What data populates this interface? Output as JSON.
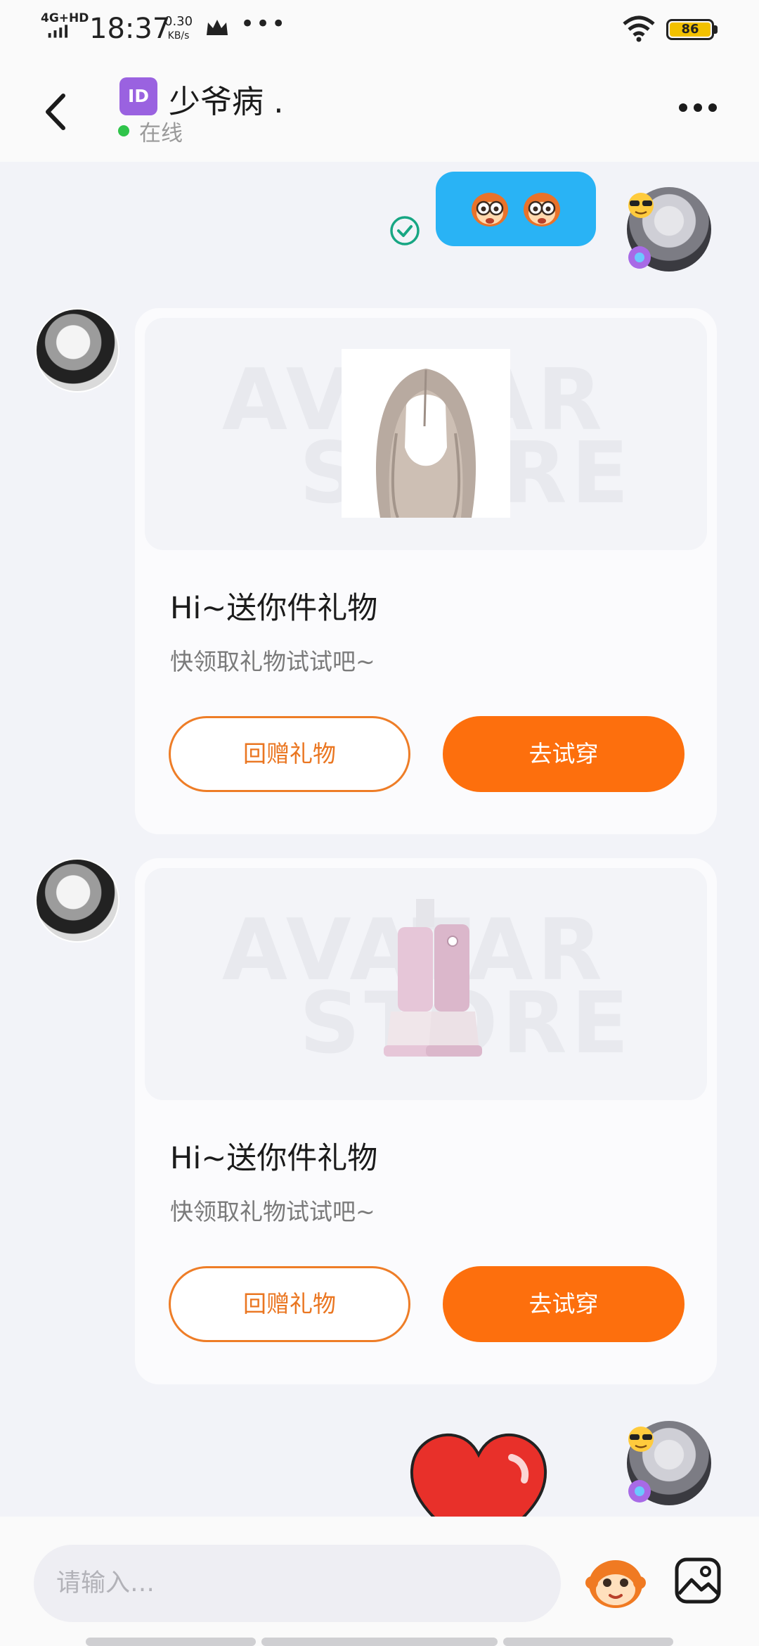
{
  "status_bar": {
    "network": "4G+HD",
    "time": "18:37",
    "speed_value": "0.30",
    "speed_unit": "KB/s",
    "more": "•••",
    "battery": "86"
  },
  "header": {
    "id_badge": "ID",
    "contact_name": "少爷病 .",
    "status": "在线"
  },
  "messages": [
    {
      "from": "self",
      "type": "emoji-sticker",
      "sticker": "monkey-face-icon x2",
      "read": true
    },
    {
      "from": "other",
      "type": "gift",
      "item": "long-hair-wig",
      "watermark": [
        "AVATAR",
        "STORE"
      ],
      "title": "Hi~送你件礼物",
      "subtitle": "快领取礼物试试吧~",
      "return_button": "回赠礼物",
      "try_button": "去试穿"
    },
    {
      "from": "other",
      "type": "gift",
      "item": "pink-leg-warmers-and-sneakers",
      "watermark": [
        "AVATAR",
        "STORE"
      ],
      "title": "Hi~送你件礼物",
      "subtitle": "快领取礼物试试吧~",
      "return_button": "回赠礼物",
      "try_button": "去试穿"
    },
    {
      "from": "self",
      "type": "emoji-sticker",
      "sticker": "red-heart-icon"
    }
  ],
  "input": {
    "placeholder": "请输入…",
    "emoji_icon": "monkey-emoji-icon",
    "gallery_icon": "image-gallery-icon"
  },
  "colors": {
    "accent_orange": "#fd6f0d",
    "bubble_blue": "#29b3f5",
    "online_green": "#2fc44a",
    "id_purple": "#9a62e0"
  }
}
